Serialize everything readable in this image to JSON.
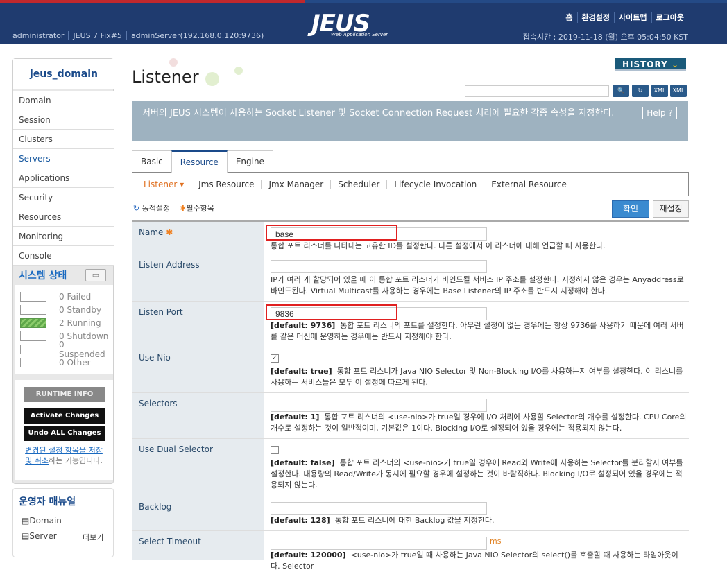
{
  "header": {
    "logo": "JEUS",
    "logo_sub": "Web Application Server",
    "links": [
      "홈",
      "환경설정",
      "사이트맵",
      "로그아웃"
    ],
    "user": "administrator",
    "version": "JEUS 7 Fix#5",
    "server": "adminServer(192.168.0.120:9736)",
    "clock": "접속시간 : 2019-11-18 (월) 오후 05:04:50 KST"
  },
  "sidebar": {
    "domain": "jeus_domain",
    "items": [
      "Domain",
      "Session",
      "Clusters",
      "Servers",
      "Applications",
      "Security",
      "Resources",
      "Monitoring",
      "Console"
    ],
    "status_title": "시스템 상태",
    "status": [
      {
        "count": "0",
        "label": "Failed"
      },
      {
        "count": "0",
        "label": "Standby"
      },
      {
        "count": "2",
        "label": "Running"
      },
      {
        "count": "0",
        "label": "Shutdown"
      },
      {
        "count": "0",
        "label": "Suspended"
      },
      {
        "count": "0",
        "label": "Other"
      }
    ],
    "runtime_info": "RUNTIME INFO",
    "activate": "Activate Changes",
    "undo": "Undo ALL Changes",
    "note_link": "변경된 설정 항목을 저장 및 취소",
    "note_rest": "하는 기능입니다.",
    "manual_title": "운영자 매뉴얼",
    "manual_domain": "Domain",
    "manual_server": "Server",
    "manual_more": "더보기"
  },
  "page": {
    "title": "Listener",
    "history": "HISTORY",
    "description": "서버의 JEUS 시스템이 사용하는 Socket Listener 및 Socket Connection Request 처리에 필요한 각종 속성을 지정한다.",
    "help": "Help",
    "tabs": [
      "Basic",
      "Resource",
      "Engine"
    ],
    "subtabs": [
      "Listener",
      "Jms Resource",
      "Jmx Manager",
      "Scheduler",
      "Lifecycle Invocation",
      "External Resource"
    ],
    "legend_dynamic": "동적설정",
    "legend_required": "필수항목",
    "ok": "확인",
    "reset": "재설정"
  },
  "form": {
    "name": {
      "label": "Name",
      "value": "base",
      "desc": "통합 포트 리스너를 나타내는 고유한 ID를 설정한다. 다른 설정에서 이 리스너에 대해 언급할 때 사용한다."
    },
    "listen_address": {
      "label": "Listen Address",
      "value": "",
      "desc": "IP가 여러 개 할당되어 있을 때 이 통합 포트 리스너가 바인드될 서비스 IP 주소를 설정한다. 지정하지 않은 경우는 Anyaddress로 바인드된다. Virtual Multicast를 사용하는 경우에는 Base Listener의 IP 주소를 반드시 지정해야 한다."
    },
    "listen_port": {
      "label": "Listen Port",
      "value": "9836",
      "default": "[default: 9736]",
      "desc": "통합 포트 리스너의 포트를 설정한다. 아무런 설정이 없는 경우에는 항상 9736를 사용하기 때문에 여러 서버를 같은 머신에 운영하는 경우에는 반드시 지정해야 한다."
    },
    "use_nio": {
      "label": "Use Nio",
      "checked": true,
      "default": "[default: true]",
      "desc": "통합 포트 리스너가 Java NIO Selector 및 Non-Blocking I/O를 사용하는지 여부를 설정한다. 이 리스너를 사용하는 서비스들은 모두 이 설정에 따르게 된다."
    },
    "selectors": {
      "label": "Selectors",
      "value": "",
      "default": "[default: 1]",
      "desc": "통합 포트 리스너의 <use-nio>가 true일 경우에 I/O 처리에 사용할 Selector의 개수를 설정한다. CPU Core의 개수로 설정하는 것이 일반적이며, 기본값은 1이다. Blocking I/O로 설정되어 있을 경우에는 적용되지 않는다."
    },
    "use_dual_selector": {
      "label": "Use Dual Selector",
      "checked": false,
      "default": "[default: false]",
      "desc": "통합 포트 리스너의 <use-nio>가 true일 경우에 Read와 Write에 사용하는 Selector를 분리할지 여부를 설정한다. 대용량의 Read/Write가 동시에 필요할 경우에 설정하는 것이 바람직하다. Blocking I/O로 설정되어 있을 경우에는 적용되지 않는다."
    },
    "backlog": {
      "label": "Backlog",
      "value": "",
      "default": "[default: 128]",
      "desc": "통합 포트 리스너에 대한 Backlog 값을 지정한다."
    },
    "select_timeout": {
      "label": "Select Timeout",
      "value": "",
      "unit": "ms",
      "default": "[default: 120000]",
      "desc": "<use-nio>가 true일 때 사용하는 Java NIO Selector의 select()를 호출할 때 사용하는 타임아웃이다. Selector"
    }
  }
}
